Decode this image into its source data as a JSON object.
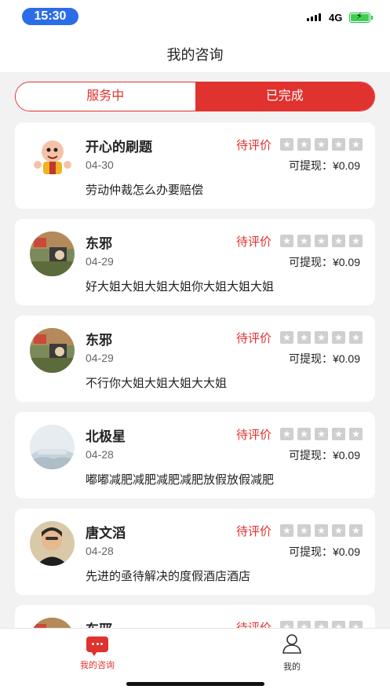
{
  "status_bar": {
    "time": "15:30",
    "network": "4G"
  },
  "nav": {
    "title": "我的咨询"
  },
  "tabs": [
    {
      "label": "服务中",
      "active": false
    },
    {
      "label": "已完成",
      "active": true
    }
  ],
  "colors": {
    "accent": "#e0322e",
    "background": "#f2f2f2",
    "star_inactive": "#cfcfcf"
  },
  "consultations": [
    {
      "name": "开心的刷题",
      "date": "04-30",
      "status": "待评价",
      "withdraw": "可提现：¥0.09",
      "question": "劳动仲裁怎么办要赔偿",
      "rating": 0,
      "avatar": "cartoon-avatar"
    },
    {
      "name": "东邪",
      "date": "04-29",
      "status": "待评价",
      "withdraw": "可提现：¥0.09",
      "question": "好大姐大姐大姐大姐你大姐大姐大姐",
      "rating": 0,
      "avatar": "photo-avatar"
    },
    {
      "name": "东邪",
      "date": "04-29",
      "status": "待评价",
      "withdraw": "可提现：¥0.09",
      "question": "不行你大姐大姐大姐大大姐",
      "rating": 0,
      "avatar": "photo-avatar"
    },
    {
      "name": "北极星",
      "date": "04-28",
      "status": "待评价",
      "withdraw": "可提现：¥0.09",
      "question": "嘟嘟减肥减肥减肥减肥放假放假减肥",
      "rating": 0,
      "avatar": "landscape-avatar"
    },
    {
      "name": "唐文滔",
      "date": "04-28",
      "status": "待评价",
      "withdraw": "可提现：¥0.09",
      "question": "先进的亟待解决的度假酒店酒店",
      "rating": 0,
      "avatar": "portrait-avatar"
    },
    {
      "name": "东邪",
      "date": "",
      "status": "待评价",
      "withdraw": "",
      "question": "",
      "rating": 0,
      "avatar": "photo-avatar"
    }
  ],
  "tab_bar": [
    {
      "label": "我的咨询",
      "icon": "chat-icon",
      "active": true
    },
    {
      "label": "我的",
      "icon": "person-icon",
      "active": false
    }
  ]
}
